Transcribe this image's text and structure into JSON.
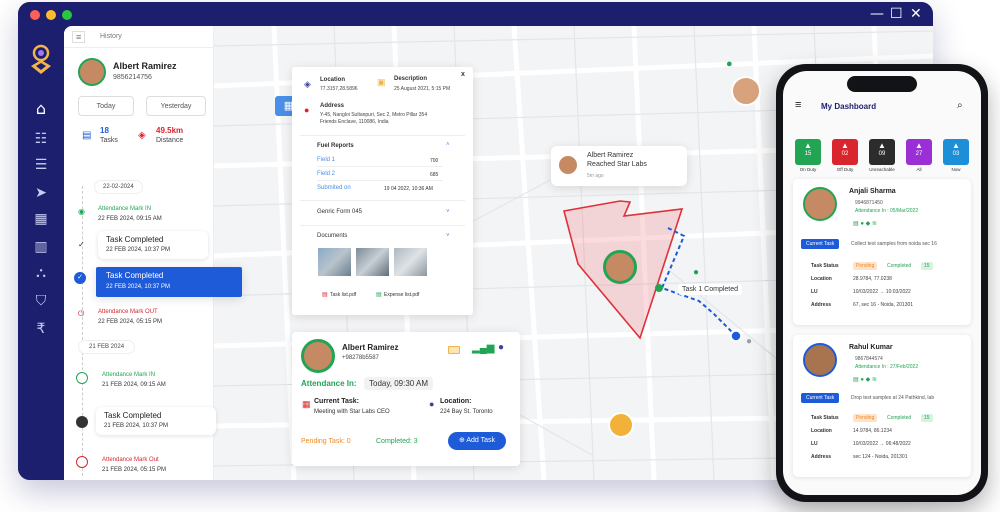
{
  "sidebar": {
    "history_label": "History"
  },
  "user": {
    "name": "Albert Ramirez",
    "phone": "9856214756"
  },
  "filters": {
    "today": "Today",
    "yesterday": "Yesterday"
  },
  "stats": {
    "tasks_value": "18",
    "tasks_label": "Tasks",
    "distance_value": "49.5km",
    "distance_label": "Distance"
  },
  "timeline": {
    "date1": "22-02-2024",
    "e1_title": "Attendance Mark IN",
    "e1_time": "22 FEB 2024, 09:15 AM",
    "e2_title": "Task Completed",
    "e2_time": "22 FEB 2024, 10:37 PM",
    "e3_title": "Task Completed",
    "e3_time": "22 FEB 2024, 10:37 PM",
    "e4_title": "Attendance Mark OUT",
    "e4_time": "22 FEB 2024, 05:15 PM",
    "date2": "21 FEB 2024",
    "f1_title": "Attendance Mark IN",
    "f1_time": "21 FEB 2024, 09:15 AM",
    "f2_title": "Task Completed",
    "f2_time": "21 FEB 2024, 10:37 PM",
    "f3_title": "Attendance Mark Out",
    "f3_time": "21 FEB 2024, 05:15 PM"
  },
  "detail": {
    "close": "x",
    "location_label": "Location",
    "location_value": "77.3157,28.5896",
    "description_label": "Description",
    "description_value": "25 August 2021, 5:15 PM",
    "address_label": "Address",
    "address_value1": "Y-45, Nangloi Sultanpuri, Sec 2, Metro Pillar 354",
    "address_value2": "Friends Enclave, 110086, India",
    "fuel_title": "Fuel Reports",
    "field1_label": "Field 1",
    "field1_value": "700",
    "field2_label": "Field 2",
    "field2_value": "685",
    "submitted_label": "Submited on",
    "submitted_value": "19 04 2022, 10:36 AM",
    "generic_form": "Genric Form 045",
    "documents": "Documents",
    "doc1": "Task list.pdf",
    "doc2": "Expense list.pdf"
  },
  "bottom_card": {
    "name": "Albert Ramirez",
    "phone": "+98278b5587",
    "attendance_label": "Attendance In:",
    "attendance_value": "Today, 09:30 AM",
    "current_task_label": "Current Task:",
    "current_task_value": "Meeting with Star Labs CEO",
    "location_label": "Location:",
    "location_value": "224 Bay St. Toronto",
    "pending": "Pending Task: 0",
    "completed": "Completed: 3",
    "add_task": "Add Task"
  },
  "map": {
    "popup_name": "Albert Ramirez",
    "popup_text": "Reached Star Labs",
    "popup_time": "5m ago",
    "task_label": "Task 1 Completed"
  },
  "phone": {
    "title": "My Dashboard",
    "tiles": [
      {
        "label": "On Duty",
        "count": "15",
        "color": "#23a455"
      },
      {
        "label": "Off Duty",
        "count": "02",
        "color": "#d9262e"
      },
      {
        "label": "Unreachable",
        "count": "09",
        "color": "#2c2c2c"
      },
      {
        "label": "All",
        "count": "27",
        "color": "#9a2fd6"
      },
      {
        "label": "Now",
        "count": "03",
        "color": "#1c8fd8"
      }
    ],
    "c1": {
      "name": "Anjali Sharma",
      "phone": "9946871450",
      "att": "Attendance In : 05/Mar/2022",
      "btn": "Current Task",
      "task": "Collect test samples from noida sec 16",
      "status_label": "Task Status",
      "pending": "Pending",
      "completed": "Completed",
      "count": "15",
      "loc_label": "Location",
      "loc": "28.9784, 77.0238",
      "lu_label": "LU",
      "lu": "10/03/2022 → 10:03/2022",
      "addr_label": "Address",
      "addr": "67, sec 16 - Noida, 201301"
    },
    "c2": {
      "name": "Rahul Kumar",
      "phone": "9867844574",
      "att": "Attendance In : 27/Feb/2022",
      "btn": "Current Task",
      "task": "Drop test samples at 24 Pathkind, lab",
      "status_label": "Task Status",
      "pending": "Pending",
      "completed": "Completed",
      "count": "15",
      "loc_label": "Location",
      "loc": "14.9784, 86.1234",
      "lu_label": "LU",
      "lu": "10/03/2022 → 06:48/2022",
      "addr_label": "Address",
      "addr": "sec 124 - Noida, 201301"
    }
  },
  "colors": {
    "navy": "#1b1f6e",
    "accent": "#1e5bd8",
    "green": "#23a455",
    "red": "#d9262e"
  }
}
